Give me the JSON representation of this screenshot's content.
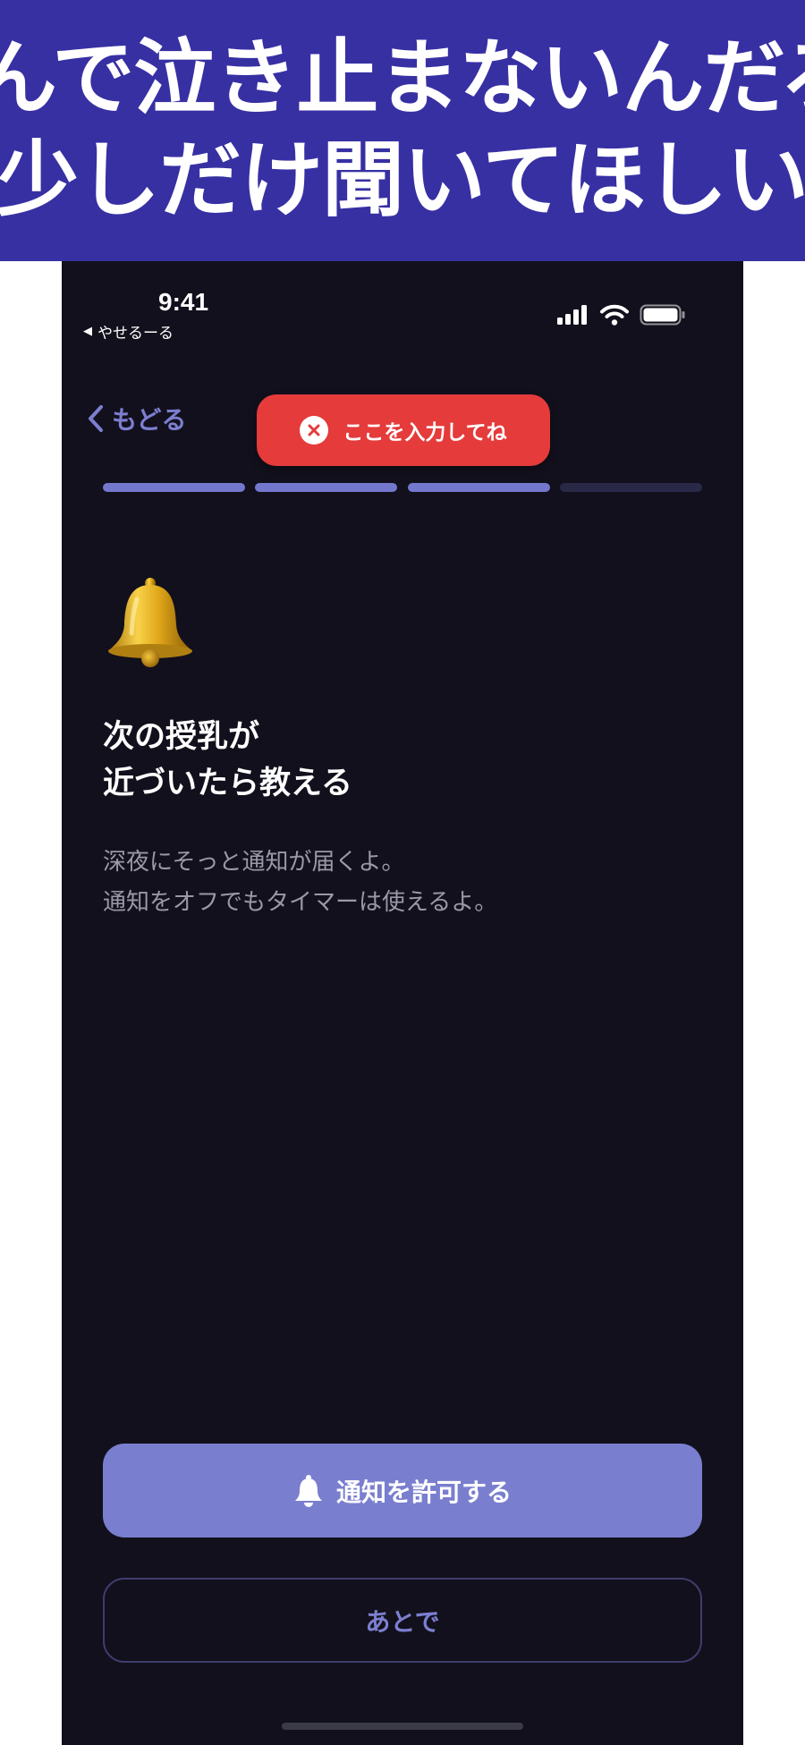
{
  "banner": {
    "line1": "んで泣き止まないんだろう",
    "line2": "少しだけ聞いてほしい。"
  },
  "status_bar": {
    "time": "9:41",
    "back_app": "やせるーる",
    "back_glyph": "◀"
  },
  "nav": {
    "back_label": "もどる"
  },
  "toast": {
    "message": "ここを入力してね",
    "icon": "close-circle-icon"
  },
  "progress": {
    "total_steps": 4,
    "completed_steps": 3
  },
  "content": {
    "icon": "bell-icon",
    "heading_line1": "次の授乳が",
    "heading_line2": "近づいたら教える",
    "desc_line1": "深夜にそっと通知が届くよ。",
    "desc_line2": "通知をオフでもタイマーは使えるよ。"
  },
  "actions": {
    "allow_label": "通知を許可する",
    "later_label": "あとで"
  },
  "colors": {
    "banner_bg": "#3730a3",
    "screen_bg": "#12101c",
    "accent": "#7a7ecf",
    "toast_bg": "#e53b3b"
  }
}
